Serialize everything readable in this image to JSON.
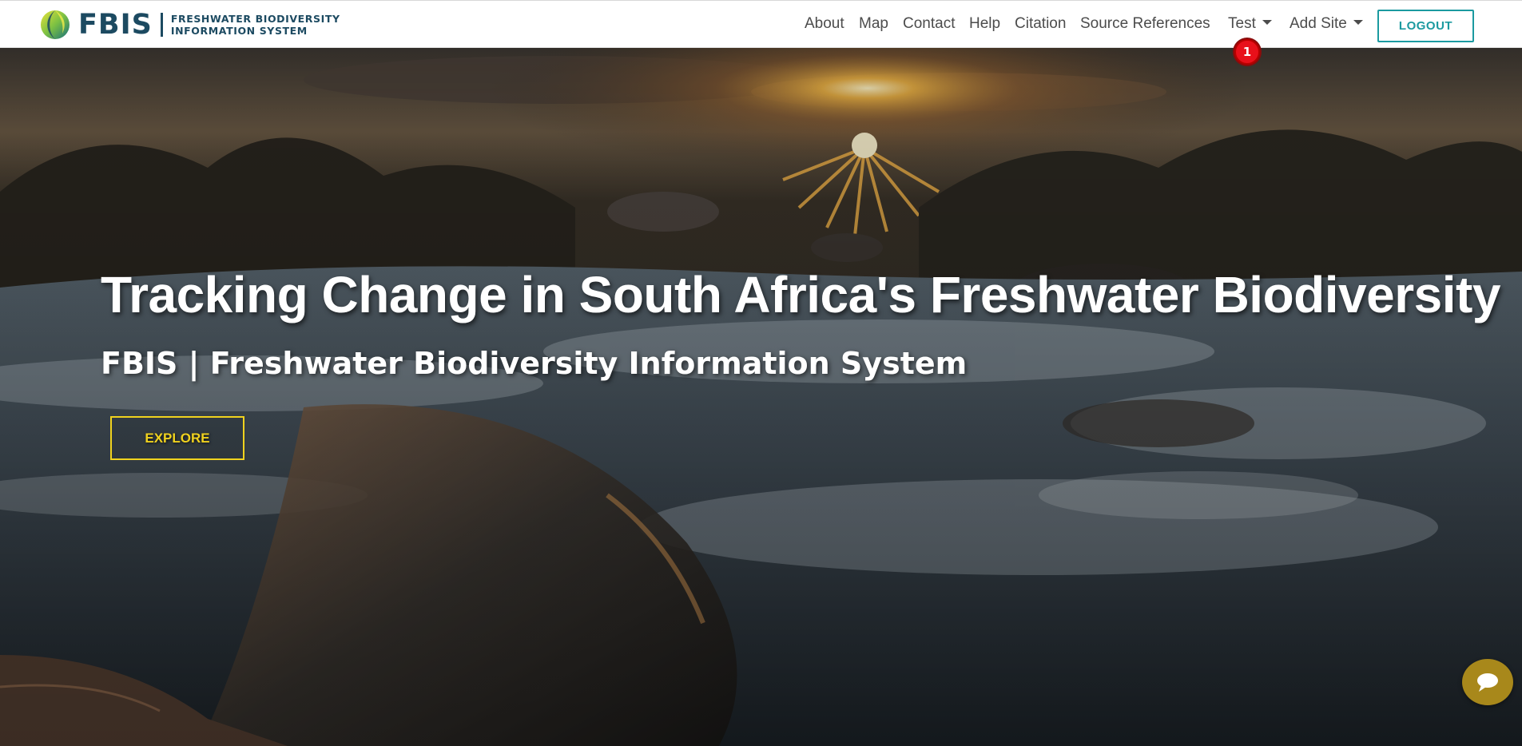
{
  "header": {
    "brand": {
      "short": "FBIS",
      "line1": "FRESHWATER BIODIVERSITY",
      "line2": "INFORMATION SYSTEM"
    },
    "nav": {
      "about": "About",
      "map": "Map",
      "contact": "Contact",
      "help": "Help",
      "citation": "Citation",
      "source_references": "Source References",
      "test": "Test",
      "add_site": "Add Site"
    },
    "logout": "LOGOUT",
    "notification_count": "1"
  },
  "hero": {
    "title": "Tracking Change in South Africa's Freshwater Biodiversity",
    "subtitle": "FBIS | Freshwater Biodiversity Information System",
    "explore": "EXPLORE"
  },
  "icons": {
    "logo": "fbis-logo-icon",
    "chat": "chat-bubble-icon",
    "dropdown": "caret-down-icon"
  },
  "colors": {
    "brand_navy": "#1c4a61",
    "logout_teal": "#1b9aa0",
    "explore_yellow": "#f0d21e",
    "badge_red": "#e8101a",
    "chat_gold": "#a8881b"
  }
}
